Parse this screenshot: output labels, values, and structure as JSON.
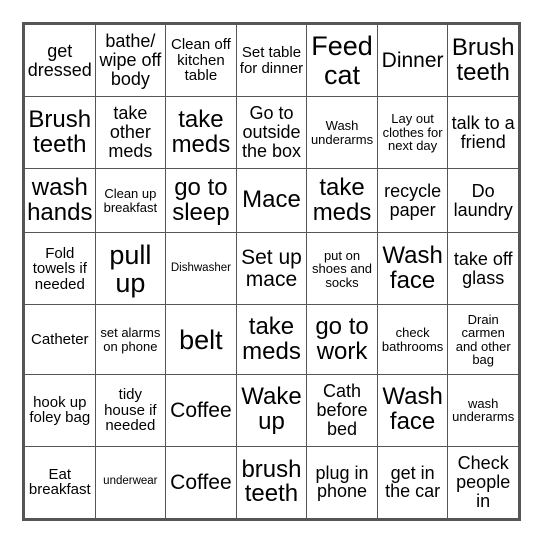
{
  "card": {
    "type": "bingo-card",
    "columns": 7,
    "rows": 7,
    "background_color": "#ffffff",
    "border_color": "#555555",
    "text_color": "#000000",
    "cells": [
      [
        {
          "text": "get dressed",
          "size": "m"
        },
        {
          "text": "bathe/ wipe off body",
          "size": "m"
        },
        {
          "text": "Clean off kitchen table",
          "size": "s"
        },
        {
          "text": "Set table for dinner",
          "size": "s"
        },
        {
          "text": "Feed cat",
          "size": "xxl"
        },
        {
          "text": "Dinner",
          "size": "l"
        },
        {
          "text": "Brush teeth",
          "size": "xl"
        }
      ],
      [
        {
          "text": "Brush teeth",
          "size": "xl"
        },
        {
          "text": "take other meds",
          "size": "m"
        },
        {
          "text": "take meds",
          "size": "xl"
        },
        {
          "text": "Go to outside the box",
          "size": "m"
        },
        {
          "text": "Wash underarms",
          "size": "xs"
        },
        {
          "text": "Lay out clothes for next day",
          "size": "xs"
        },
        {
          "text": "talk to a friend",
          "size": "m"
        }
      ],
      [
        {
          "text": "wash hands",
          "size": "xl"
        },
        {
          "text": "Clean up breakfast",
          "size": "xs"
        },
        {
          "text": "go to sleep",
          "size": "xl"
        },
        {
          "text": "Mace",
          "size": "xl"
        },
        {
          "text": "take meds",
          "size": "xl"
        },
        {
          "text": "recycle paper",
          "size": "m"
        },
        {
          "text": "Do laundry",
          "size": "m"
        }
      ],
      [
        {
          "text": "Fold towels if needed",
          "size": "s"
        },
        {
          "text": "pull up",
          "size": "xxl"
        },
        {
          "text": "Dishwasher",
          "size": "xxs"
        },
        {
          "text": "Set up mace",
          "size": "l"
        },
        {
          "text": "put on shoes and socks",
          "size": "xs"
        },
        {
          "text": "Wash face",
          "size": "xl"
        },
        {
          "text": "take off glass",
          "size": "m"
        }
      ],
      [
        {
          "text": "Catheter",
          "size": "s"
        },
        {
          "text": "set alarms on phone",
          "size": "xs"
        },
        {
          "text": "belt",
          "size": "xxl"
        },
        {
          "text": "take meds",
          "size": "xl"
        },
        {
          "text": "go to work",
          "size": "xl"
        },
        {
          "text": "check bathrooms",
          "size": "xs"
        },
        {
          "text": "Drain carmen and other bag",
          "size": "xs"
        }
      ],
      [
        {
          "text": "hook up foley bag",
          "size": "s"
        },
        {
          "text": "tidy house if needed",
          "size": "s"
        },
        {
          "text": "Coffee",
          "size": "l"
        },
        {
          "text": "Wake up",
          "size": "xl"
        },
        {
          "text": "Cath before bed",
          "size": "m"
        },
        {
          "text": "Wash face",
          "size": "xl"
        },
        {
          "text": "wash underarms",
          "size": "xs"
        }
      ],
      [
        {
          "text": "Eat breakfast",
          "size": "s"
        },
        {
          "text": "underwear",
          "size": "xxs"
        },
        {
          "text": "Coffee",
          "size": "l"
        },
        {
          "text": "brush teeth",
          "size": "xl"
        },
        {
          "text": "plug in phone",
          "size": "m"
        },
        {
          "text": "get in the car",
          "size": "m"
        },
        {
          "text": "Check people in",
          "size": "m"
        }
      ]
    ]
  }
}
